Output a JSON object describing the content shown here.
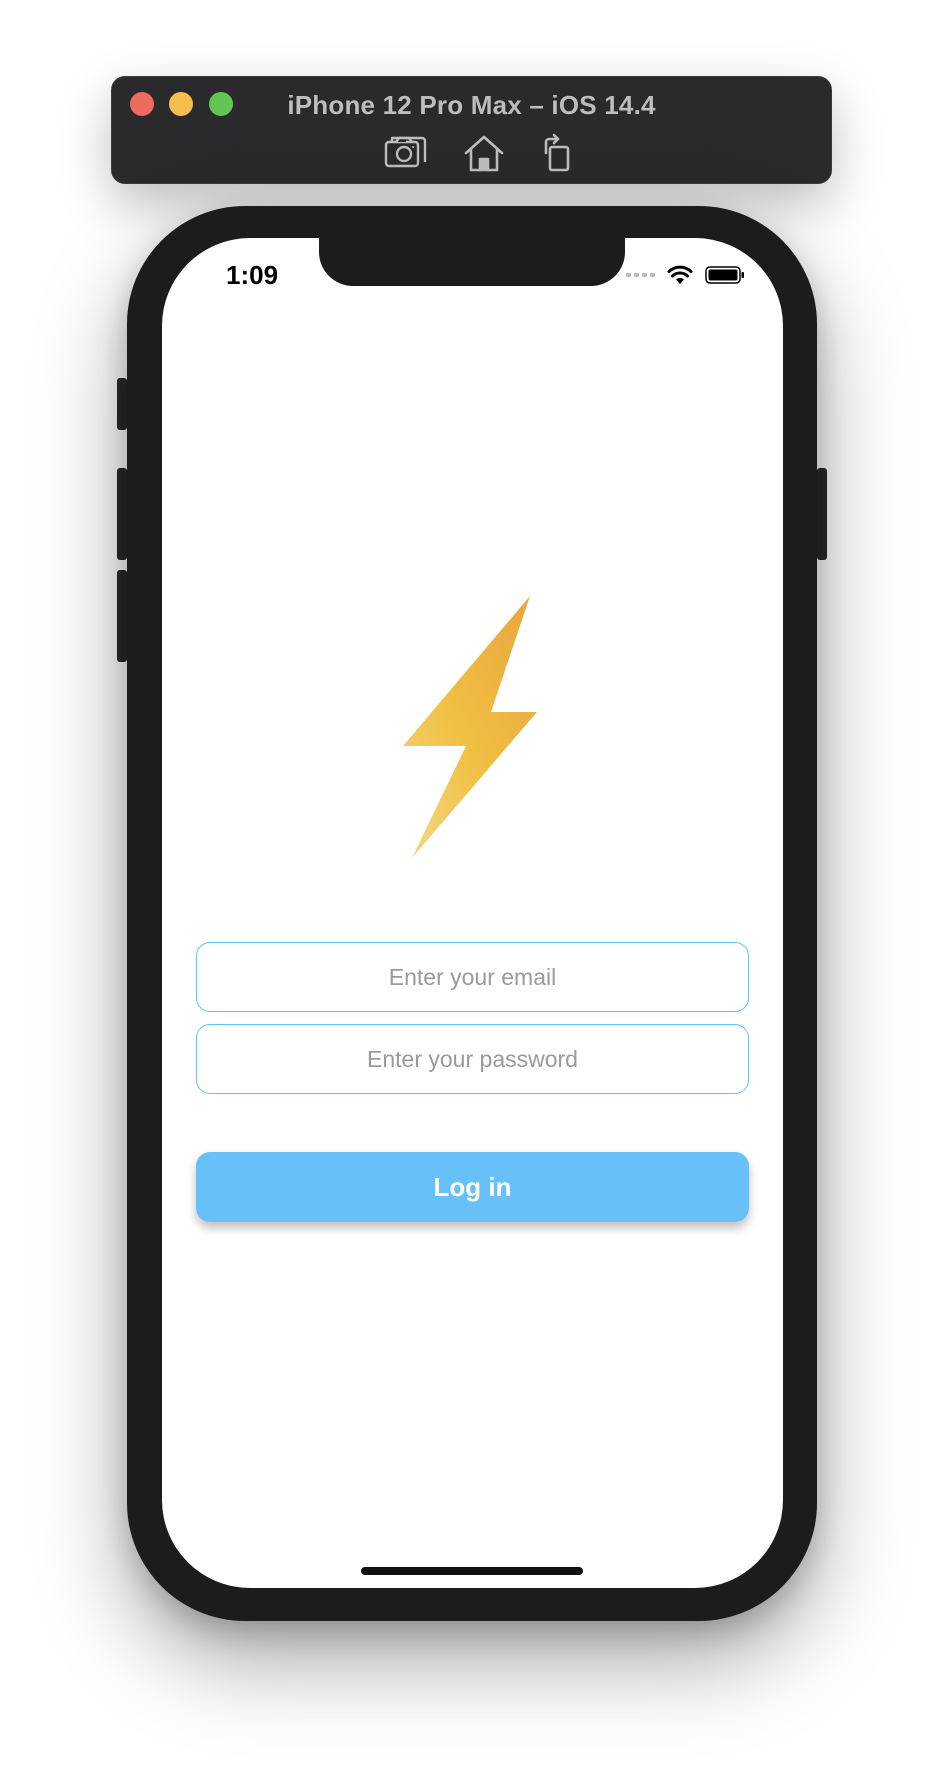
{
  "simulator": {
    "title": "iPhone 12 Pro Max – iOS 14.4",
    "toolbar_icons": [
      "camera-icon",
      "home-icon",
      "rotate-icon"
    ],
    "traffic_lights": {
      "close": "#ed6a5e",
      "minimize": "#f5bf4f",
      "zoom": "#61c554"
    }
  },
  "status_bar": {
    "time": "1:09",
    "icons": [
      "signal-icon",
      "wifi-icon",
      "battery-icon"
    ]
  },
  "app": {
    "logo_icon": "lightning-bolt-icon",
    "email": {
      "placeholder": "Enter your email",
      "value": ""
    },
    "password": {
      "placeholder": "Enter your password",
      "value": ""
    },
    "login_label": "Log in"
  },
  "colors": {
    "accent": "#67c1f8",
    "field_border": "#5ec3f7",
    "bolt_top": "#e9a43c",
    "bolt_bottom": "#f3d98a"
  }
}
